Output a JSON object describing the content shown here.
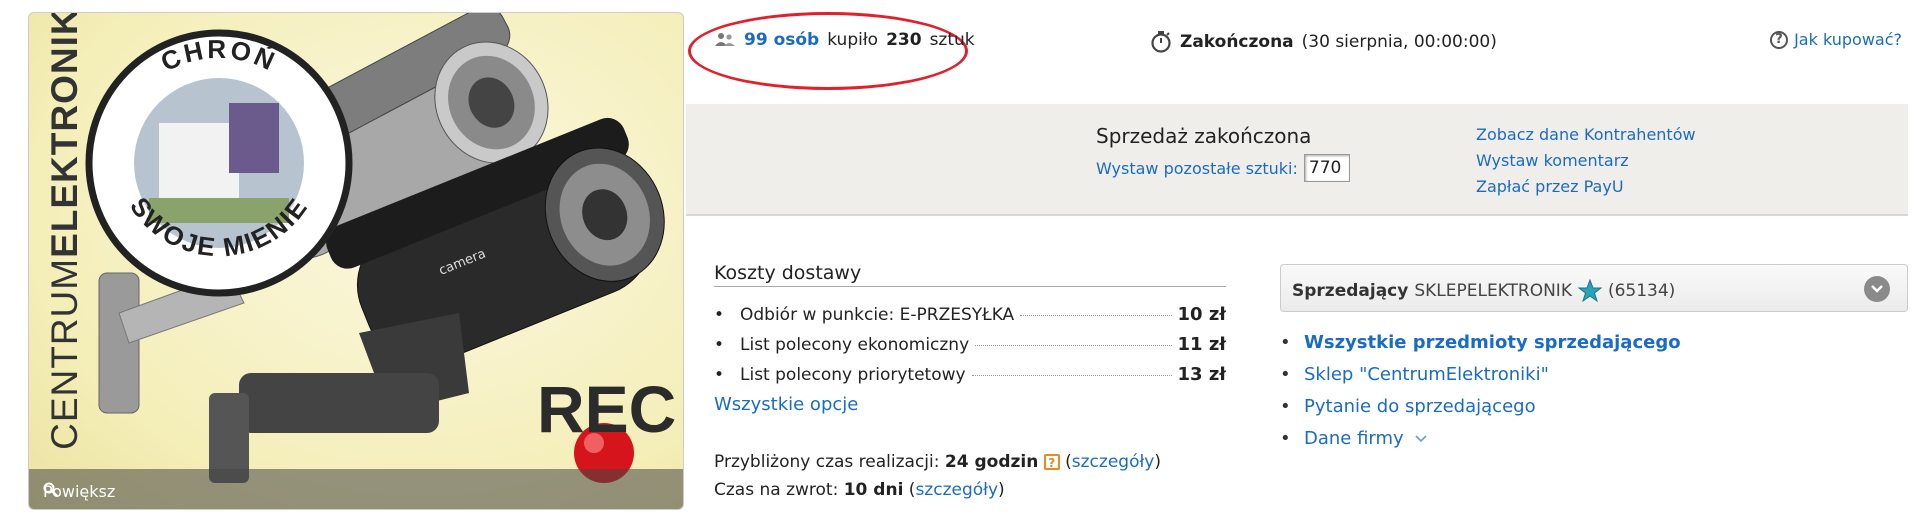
{
  "image": {
    "brand_text_light": "CENTRUM",
    "brand_text_bold": "ELEKTRONIKI",
    "badge_top": "CHROŃ",
    "badge_bottom": "SWOJE MIENIE",
    "rec_label": "REC",
    "camera_label": "camera",
    "zoom_label": "Powiększ"
  },
  "buyers": {
    "count": "99 osób",
    "bought_text": "kupiło",
    "quantity": "230",
    "unit": "sztuk"
  },
  "auction_status": {
    "label": "Zakończona",
    "date": "(30 sierpnia, 00:00:00)"
  },
  "help": {
    "label": "Jak kupować?"
  },
  "status_panel": {
    "title": "Sprzedaż zakończona",
    "relist_label": "Wystaw pozostałe sztuki:",
    "relist_quantity": "770",
    "links": [
      "Zobacz dane Kontrahentów",
      "Wystaw komentarz",
      "Zapłać przez PayU"
    ]
  },
  "shipping": {
    "title": "Koszty dostawy",
    "options": [
      {
        "name": "Odbiór w punkcie: E-PRZESYŁKA",
        "price": "10 zł"
      },
      {
        "name": "List polecony ekonomiczny",
        "price": "11 zł"
      },
      {
        "name": "List polecony priorytetowy",
        "price": "13 zł"
      }
    ],
    "all_options_label": "Wszystkie opcje",
    "realization_label": "Przybliżony czas realizacji:",
    "realization_value": "24 godzin",
    "return_label": "Czas na zwrot:",
    "return_value": "10 dni",
    "details_label": "szczegóły"
  },
  "seller": {
    "label": "Sprzedający",
    "name": "SKLEPELEKTRONIK",
    "rating": "(65134)",
    "links": [
      {
        "label": "Wszystkie przedmioty sprzedającego",
        "bold": true
      },
      {
        "label": "Sklep \"CentrumElektroniki\"",
        "bold": false
      },
      {
        "label": "Pytanie do sprzedającego",
        "bold": false
      },
      {
        "label": "Dane firmy",
        "bold": false
      }
    ]
  },
  "colors": {
    "link": "#1a6bc4",
    "highlight_ellipse": "#e0212b",
    "panel_bg": "#f0eeea",
    "star": "#2aa3b8"
  }
}
